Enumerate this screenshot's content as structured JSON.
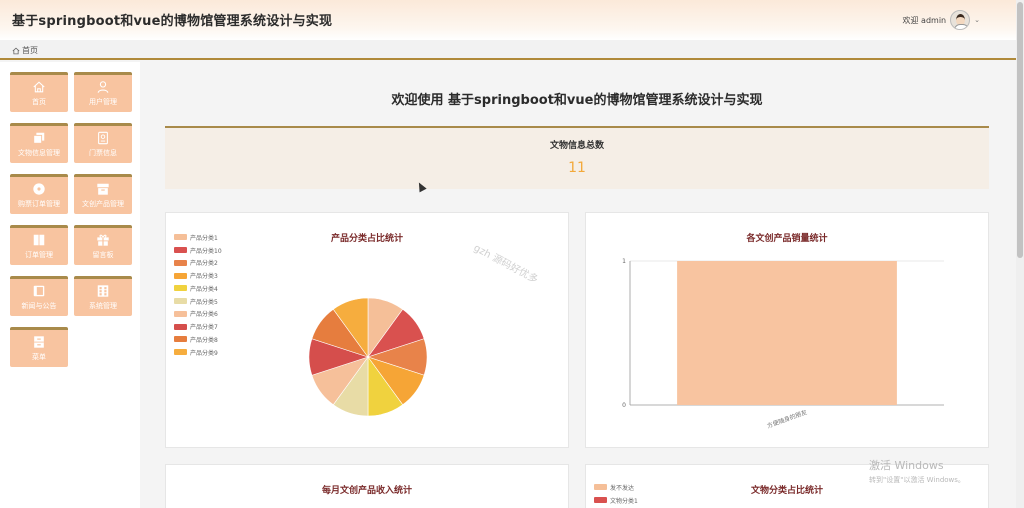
{
  "header": {
    "title": "基于springboot和vue的博物馆管理系统设计与实现",
    "user_label": "欢迎 admin"
  },
  "breadcrumb": {
    "home": "首页"
  },
  "sidebar": {
    "items": [
      {
        "label": "首页",
        "icon": "home-icon"
      },
      {
        "label": "用户管理",
        "icon": "user-icon"
      },
      {
        "label": "文物信息管理",
        "icon": "copy-icon"
      },
      {
        "label": "门票信息",
        "icon": "ticket-icon"
      },
      {
        "label": "购票订单管理",
        "icon": "disc-icon"
      },
      {
        "label": "文创产品管理",
        "icon": "box-icon"
      },
      {
        "label": "订单管理",
        "icon": "book-icon"
      },
      {
        "label": "留言板",
        "icon": "gift-icon"
      },
      {
        "label": "新闻与公告",
        "icon": "notebook-icon"
      },
      {
        "label": "系统管理",
        "icon": "grid-icon"
      },
      {
        "label": "菜单",
        "icon": "cabinet-icon"
      }
    ]
  },
  "main": {
    "welcome": "欢迎使用 基于springboot和vue的博物馆管理系统设计与实现",
    "stat": {
      "title": "文物信息总数",
      "value": "11"
    },
    "watermark": "gzh 源码好优多",
    "panels": {
      "pie": {
        "title": "产品分类占比统计"
      },
      "bar": {
        "title": "各文创产品销量统计"
      },
      "monthly": {
        "title": "每月文创产品收入统计"
      },
      "relic": {
        "title": "文物分类占比统计"
      }
    }
  },
  "overlay": {
    "activate_title": "激活 Windows",
    "activate_sub": "转到\"设置\"以激活 Windows。"
  },
  "colors": {
    "accent": "#a88a4a",
    "menu_bg": "#f8c4a0",
    "stat_value": "#f3a93a",
    "panel_title": "#7a2a2a",
    "bar_fill": "#f8c4a0"
  },
  "chart_data": [
    {
      "type": "pie",
      "title": "产品分类占比统计",
      "legend_position": "top-left",
      "series": [
        {
          "name": "产品分类1",
          "value": 1,
          "color": "#f5bf98"
        },
        {
          "name": "产品分类10",
          "value": 1,
          "color": "#d9514f"
        },
        {
          "name": "产品分类2",
          "value": 1,
          "color": "#e8834a"
        },
        {
          "name": "产品分类3",
          "value": 1,
          "color": "#f6a536"
        },
        {
          "name": "产品分类4",
          "value": 1,
          "color": "#f0d23e"
        },
        {
          "name": "产品分类5",
          "value": 1,
          "color": "#e8dca6"
        },
        {
          "name": "产品分类6",
          "value": 1,
          "color": "#f6c09a"
        },
        {
          "name": "产品分类7",
          "value": 1,
          "color": "#d54e4c"
        },
        {
          "name": "产品分类8",
          "value": 1,
          "color": "#e67d3e"
        },
        {
          "name": "产品分类9",
          "value": 1,
          "color": "#f6ad3e"
        }
      ]
    },
    {
      "type": "bar",
      "title": "各文创产品销量统计",
      "categories": [
        "方便随身的朋友"
      ],
      "values": [
        1
      ],
      "ylim": [
        0,
        1
      ],
      "yticks": [
        "0",
        "1"
      ]
    },
    {
      "type": "pie",
      "title": "文物分类占比统计",
      "legend_position": "top-left",
      "series": [
        {
          "name": "发不发达",
          "color": "#f5bf98"
        },
        {
          "name": "文物分类1",
          "color": "#d9514f"
        }
      ]
    }
  ]
}
